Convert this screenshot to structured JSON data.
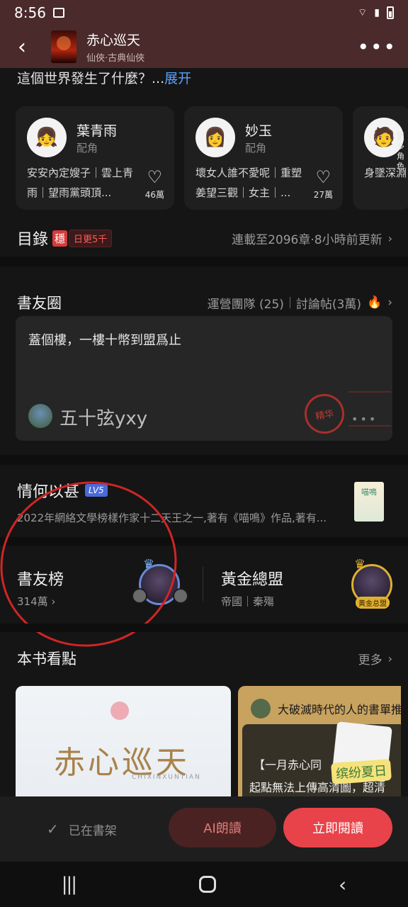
{
  "status": {
    "time": "8:56"
  },
  "header": {
    "title": "赤心巡天",
    "subtitle": "仙俠·古典仙俠"
  },
  "intro": {
    "text": "這個世界發生了什麼？...",
    "expand": "展开"
  },
  "characters": [
    {
      "name": "葉青雨",
      "role": "配角",
      "desc": "安安內定嫂子｜雲上青雨｜望雨黨頭頂...",
      "likes": "46萬"
    },
    {
      "name": "妙玉",
      "role": "配角",
      "desc": "壞女人誰不愛呢｜重塑姜望三觀｜女主｜...",
      "likes": "27萬"
    },
    {
      "name": "",
      "role": "",
      "desc": "身墜深淵｜是爲騰龍",
      "likes": ""
    }
  ],
  "more_roles": "更多角色",
  "toc": {
    "title": "目錄",
    "stable_badge": "穩",
    "daily_badge": "日更5千",
    "right": "連載至2096章·8小時前更新"
  },
  "circle": {
    "title": "書友圈",
    "team": "運營團隊 (25)",
    "posts": "討論帖(3萬)",
    "post_text": "蓋個樓，一樓十幣到盟爲止",
    "poster": "五十弦yxy",
    "stamp": "精华"
  },
  "author": {
    "name": "情何以甚",
    "level": "LV5",
    "desc": "2022年網絡文學榜樣作家十二天王之一,著有《喵鳴》作品,著有...",
    "book_label": "喵鳴"
  },
  "rank": {
    "title": "書友榜",
    "count": "314萬"
  },
  "gold": {
    "title": "黃金總盟",
    "sub": "帝國｜秦殤",
    "tag": "黃金总盟"
  },
  "highlights": {
    "title": "本书看點",
    "more": "更多",
    "card1_title": "赤心巡天",
    "card1_tag": "CHIXINXUNTIAN",
    "card2_title": "大破滅時代的人的書單推",
    "card2_line1": "【一月赤心同",
    "card2_line2": "起點無法上傳高清圖，超清",
    "sticker": "缤纷夏日"
  },
  "bottom": {
    "shelf": "已在書架",
    "ai": "AI朗讀",
    "read": "立即閱讀"
  },
  "colors": {
    "accent": "#e8434a",
    "link": "#5aa0ff",
    "header_bg": "#4a2a2a"
  }
}
